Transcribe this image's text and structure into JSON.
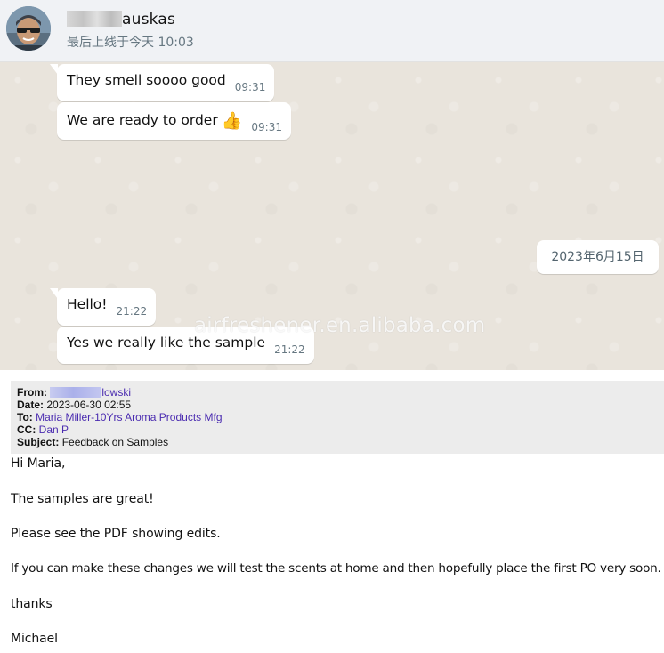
{
  "chat_header": {
    "contact_name_visible": "auskas",
    "last_seen": "最后上线于今天 10:03"
  },
  "messages": [
    {
      "text": "They smell soooo good",
      "time": "09:31",
      "emoji": ""
    },
    {
      "text": "We are ready to order",
      "time": "09:31",
      "emoji": "👍"
    },
    {
      "text": "Hello!",
      "time": "21:22",
      "emoji": ""
    },
    {
      "text": "Yes we really like the sample",
      "time": "21:22",
      "emoji": ""
    }
  ],
  "date_separator": "2023年6月15日",
  "watermark": "airfreshener.en.alibaba.com",
  "email": {
    "from_label": "From:",
    "from_value_visible": "lowski",
    "date_label": "Date:",
    "date_value": "2023-06-30 02:55",
    "to_label": "To:",
    "to_value": "Maria Miller-10Yrs Aroma Products Mfg",
    "cc_label": "CC:",
    "cc_value": "Dan P",
    "subject_label": "Subject:",
    "subject_value": "Feedback on Samples",
    "body_lines": [
      "Hi Maria,",
      "The samples are great!",
      "Please see the PDF showing edits.",
      "If you can make these changes we will test the scents at home and then hopefully place the first PO very soon.",
      "thanks",
      "Michael"
    ]
  },
  "colors": {
    "chat_background": "#e9e4dc",
    "header_background": "#f0f2f5",
    "bubble": "#ffffff",
    "timestamp": "#667781",
    "email_header_background": "#ececec",
    "email_link": "#4a2bb0"
  }
}
